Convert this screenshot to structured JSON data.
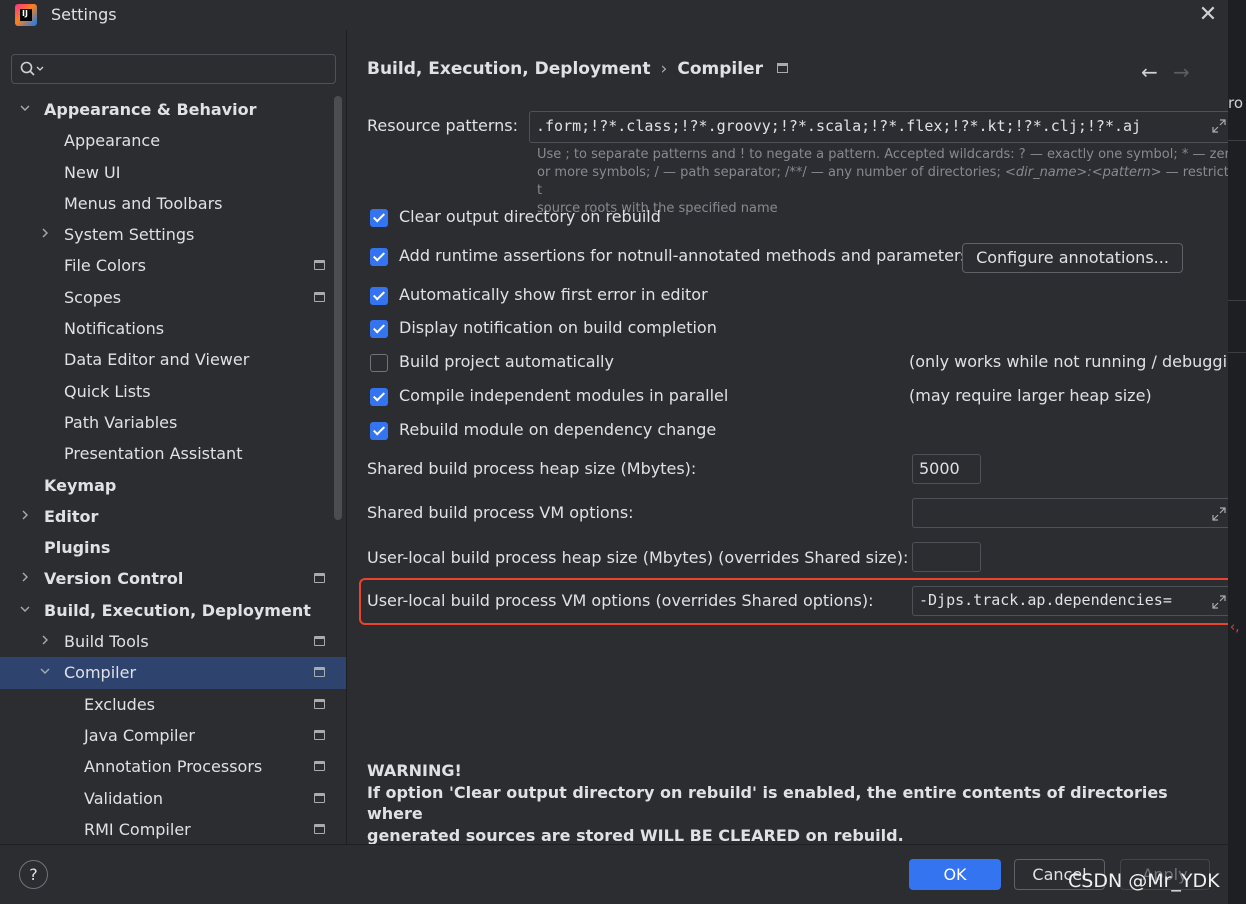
{
  "window": {
    "title": "Settings",
    "app_icon": "intellij-idea-icon",
    "close_glyph": "✕"
  },
  "background": {
    "partial_text": "ro"
  },
  "sidebar": {
    "search": {
      "placeholder": "",
      "value": ""
    },
    "items": [
      {
        "label": "Appearance & Behavior",
        "level": 0,
        "chevron": "down",
        "bold": true,
        "icon": false
      },
      {
        "label": "Appearance",
        "level": 1,
        "chevron": "none",
        "bold": false,
        "icon": false
      },
      {
        "label": "New UI",
        "level": 1,
        "chevron": "none",
        "bold": false,
        "icon": false
      },
      {
        "label": "Menus and Toolbars",
        "level": 1,
        "chevron": "none",
        "bold": false,
        "icon": false
      },
      {
        "label": "System Settings",
        "level": 1,
        "chevron": "right",
        "bold": false,
        "icon": false
      },
      {
        "label": "File Colors",
        "level": 1,
        "chevron": "none",
        "bold": false,
        "icon": true
      },
      {
        "label": "Scopes",
        "level": 1,
        "chevron": "none",
        "bold": false,
        "icon": true
      },
      {
        "label": "Notifications",
        "level": 1,
        "chevron": "none",
        "bold": false,
        "icon": false
      },
      {
        "label": "Data Editor and Viewer",
        "level": 1,
        "chevron": "none",
        "bold": false,
        "icon": false
      },
      {
        "label": "Quick Lists",
        "level": 1,
        "chevron": "none",
        "bold": false,
        "icon": false
      },
      {
        "label": "Path Variables",
        "level": 1,
        "chevron": "none",
        "bold": false,
        "icon": false
      },
      {
        "label": "Presentation Assistant",
        "level": 1,
        "chevron": "none",
        "bold": false,
        "icon": false
      },
      {
        "label": "Keymap",
        "level": 0,
        "chevron": "none",
        "bold": true,
        "icon": false
      },
      {
        "label": "Editor",
        "level": 0,
        "chevron": "right",
        "bold": true,
        "icon": false
      },
      {
        "label": "Plugins",
        "level": 0,
        "chevron": "none",
        "bold": true,
        "icon": false
      },
      {
        "label": "Version Control",
        "level": 0,
        "chevron": "right",
        "bold": true,
        "icon": true
      },
      {
        "label": "Build, Execution, Deployment",
        "level": 0,
        "chevron": "down",
        "bold": true,
        "icon": false
      },
      {
        "label": "Build Tools",
        "level": 1,
        "chevron": "right",
        "bold": false,
        "icon": true
      },
      {
        "label": "Compiler",
        "level": 1,
        "chevron": "down",
        "bold": false,
        "icon": true,
        "selected": true
      },
      {
        "label": "Excludes",
        "level": 2,
        "chevron": "none",
        "bold": false,
        "icon": true
      },
      {
        "label": "Java Compiler",
        "level": 2,
        "chevron": "none",
        "bold": false,
        "icon": true
      },
      {
        "label": "Annotation Processors",
        "level": 2,
        "chevron": "none",
        "bold": false,
        "icon": true
      },
      {
        "label": "Validation",
        "level": 2,
        "chevron": "none",
        "bold": false,
        "icon": true
      },
      {
        "label": "RMI Compiler",
        "level": 2,
        "chevron": "none",
        "bold": false,
        "icon": true
      }
    ]
  },
  "main": {
    "breadcrumb": {
      "parent": "Build, Execution, Deployment",
      "separator": "›",
      "current": "Compiler"
    },
    "nav": {
      "back": "←",
      "forward": "→"
    },
    "resource_patterns": {
      "label": "Resource patterns:",
      "value": ".form;!?*.class;!?*.groovy;!?*.scala;!?*.flex;!?*.kt;!?*.clj;!?*.aj",
      "hint_line1_a": "Use ; to separate patterns and ! to negate a pattern. Accepted wildcards: ? — exactly one symbol; * — zer",
      "hint_line2_a": "or more symbols; / — path separator; /**/ — any number of directories; ",
      "hint_line2_b": "<dir_name>:<pattern>",
      "hint_line2_c": " — restrict t",
      "hint_line3": "source roots with the specified name"
    },
    "checkboxes": [
      {
        "label": "Clear output directory on rebuild",
        "checked": true
      },
      {
        "label": "Add runtime assertions for notnull-annotated methods and parameters",
        "checked": true
      },
      {
        "label": "Automatically show first error in editor",
        "checked": true
      },
      {
        "label": "Display notification on build completion",
        "checked": true
      },
      {
        "label": "Build project automatically",
        "checked": false
      },
      {
        "label": "Compile independent modules in parallel",
        "checked": true
      },
      {
        "label": "Rebuild module on dependency change",
        "checked": true
      }
    ],
    "configure_annotations_label": "Configure annotations...",
    "notes": {
      "build_auto": "(only works while not running / debugging",
      "parallel": "(may require larger heap size)"
    },
    "shared_heap": {
      "label": "Shared build process heap size (Mbytes):",
      "value": "5000"
    },
    "shared_vm": {
      "label": "Shared build process VM options:",
      "value": ""
    },
    "user_heap": {
      "label": "User-local build process heap size (Mbytes) (overrides Shared size):",
      "value": ""
    },
    "user_vm": {
      "label": "User-local build process VM options (overrides Shared options):",
      "value": "-Djps.track.ap.dependencies="
    },
    "warning": {
      "title": "WARNING!",
      "line1": "If option 'Clear output directory on rebuild' is enabled, the entire contents of directories where",
      "line2": "generated sources are stored WILL BE CLEARED on rebuild."
    }
  },
  "footer": {
    "help": "?",
    "ok": "OK",
    "cancel": "Cancel",
    "apply": "Apply"
  },
  "watermark": "CSDN @Mr_YDK",
  "colors": {
    "accent": "#3574f0",
    "selection": "#2e436e",
    "highlight_box": "#e8442e",
    "background": "#2b2d30"
  }
}
